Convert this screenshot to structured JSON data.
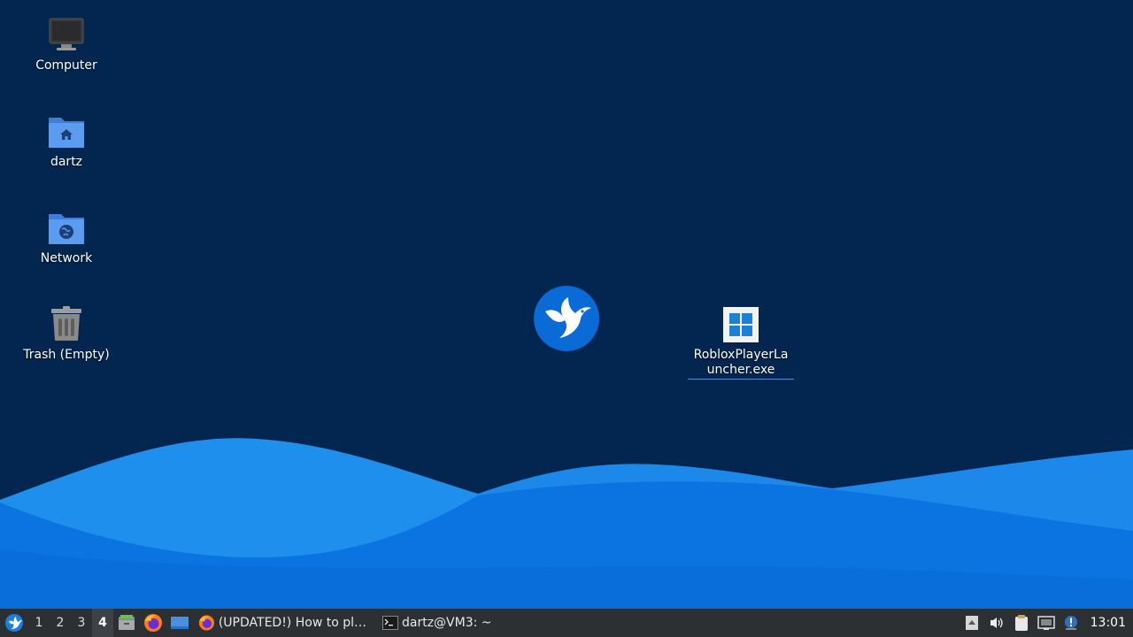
{
  "desktop": {
    "icons": [
      {
        "label": "Computer",
        "icon": "computer-icon"
      },
      {
        "label": "dartz",
        "icon": "home-folder-icon"
      },
      {
        "label": "Network",
        "icon": "network-folder-icon"
      },
      {
        "label": "Trash (Empty)",
        "icon": "trash-icon"
      },
      {
        "label": "RobloxPlayerLauncher.exe",
        "icon": "windows-exe-icon"
      }
    ],
    "wallpaper_colors": {
      "background": "#02264f",
      "wave_light": "#2a9df4",
      "wave_dark": "#0a6fd8"
    }
  },
  "taskbar": {
    "menu_icon": "lubuntu-menu-icon",
    "workspaces": [
      "1",
      "2",
      "3",
      "4"
    ],
    "active_workspace": "4",
    "launchers": [
      "file-manager-icon",
      "firefox-icon",
      "show-desktop-icon"
    ],
    "tasks": [
      {
        "label": "(UPDATED!) How to pl…",
        "icon": "firefox-icon"
      },
      {
        "label": "dartz@VM3: ~",
        "icon": "terminal-icon"
      }
    ],
    "tray": [
      "tray-up-arrow-icon",
      "volume-icon",
      "clipboard-icon",
      "network-icon",
      "update-notifier-icon"
    ],
    "clock": "13:01"
  }
}
